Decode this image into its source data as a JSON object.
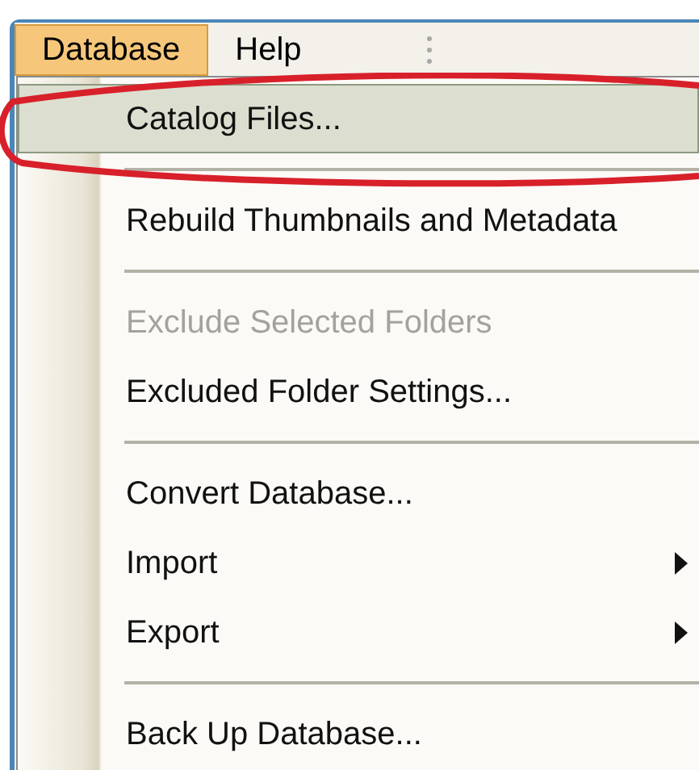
{
  "menu_bar": [
    {
      "label": "Database",
      "selected": true
    },
    {
      "label": "Help",
      "selected": false
    }
  ],
  "menu": [
    {
      "kind": "item",
      "label": "Catalog Files...",
      "selected": true,
      "disabled": false,
      "submenu": false
    },
    {
      "kind": "separator"
    },
    {
      "kind": "item",
      "label": "Rebuild Thumbnails and Metadata",
      "selected": false,
      "disabled": false,
      "submenu": false
    },
    {
      "kind": "separator"
    },
    {
      "kind": "item",
      "label": "Exclude Selected Folders",
      "selected": false,
      "disabled": true,
      "submenu": false
    },
    {
      "kind": "item",
      "label": "Excluded Folder Settings...",
      "selected": false,
      "disabled": false,
      "submenu": false
    },
    {
      "kind": "separator"
    },
    {
      "kind": "item",
      "label": "Convert Database...",
      "selected": false,
      "disabled": false,
      "submenu": false
    },
    {
      "kind": "item",
      "label": "Import",
      "selected": false,
      "disabled": false,
      "submenu": true
    },
    {
      "kind": "item",
      "label": "Export",
      "selected": false,
      "disabled": false,
      "submenu": true
    },
    {
      "kind": "separator"
    },
    {
      "kind": "item",
      "label": "Back Up Database...",
      "selected": false,
      "disabled": false,
      "submenu": false
    }
  ]
}
